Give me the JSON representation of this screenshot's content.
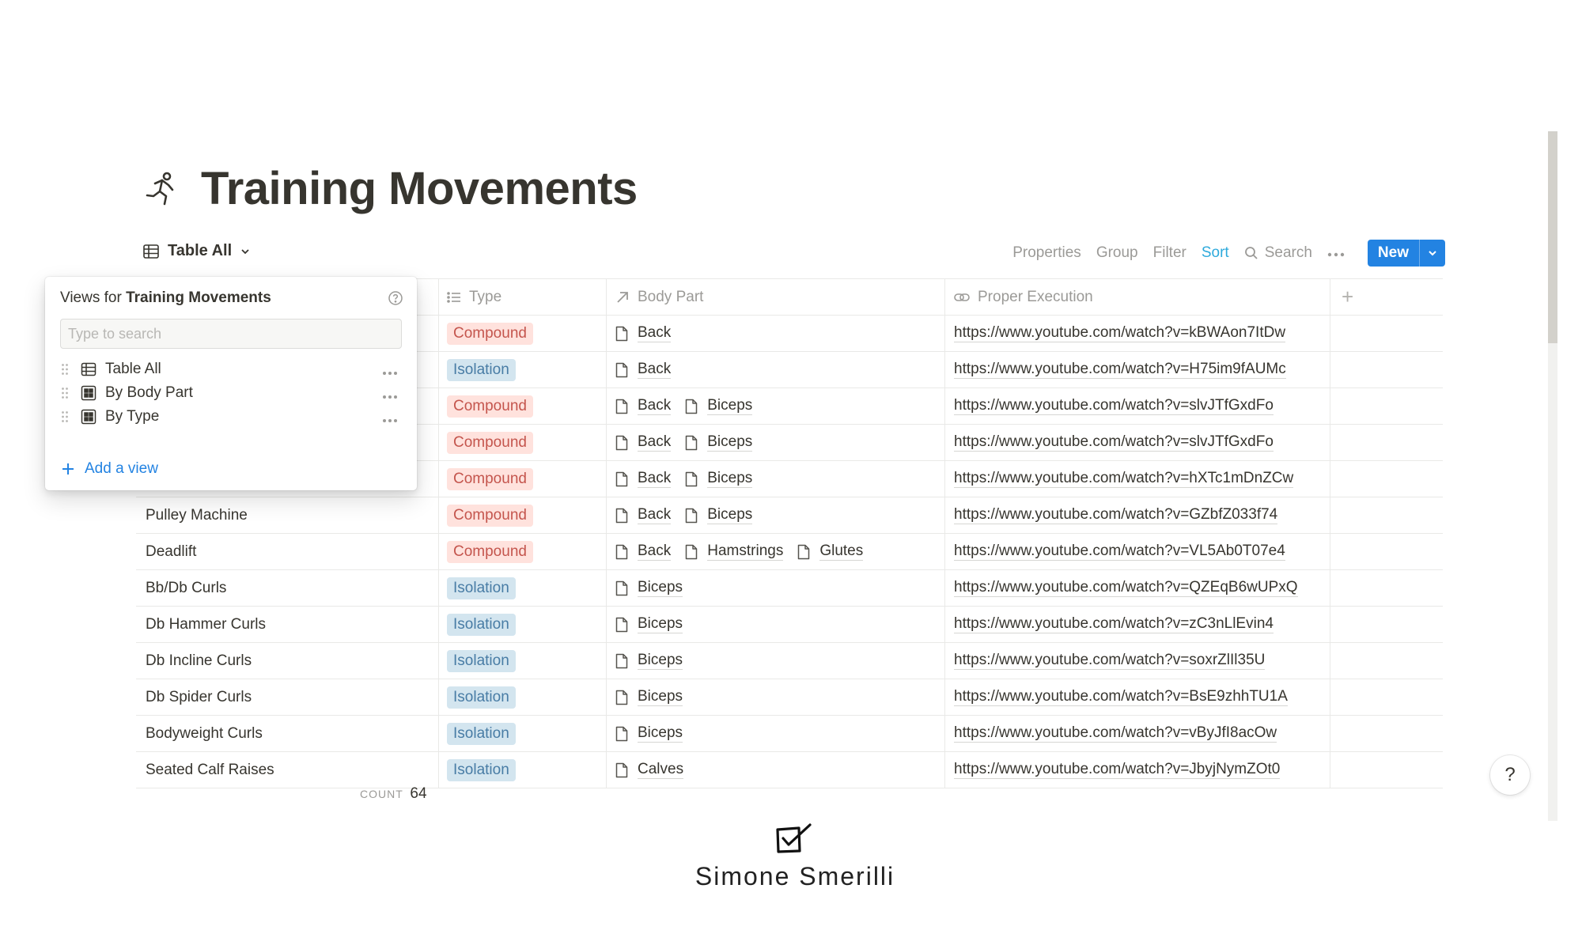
{
  "page": {
    "title": "Training Movements",
    "icon": "running-person-icon"
  },
  "toolbar": {
    "view_label": "Table All",
    "properties": "Properties",
    "group": "Group",
    "filter": "Filter",
    "sort": "Sort",
    "search": "Search",
    "new": "New"
  },
  "table": {
    "headers": {
      "type": "Type",
      "body_part": "Body Part",
      "proper_execution": "Proper Execution"
    },
    "rows": [
      {
        "name": "",
        "type": "Compound",
        "body": [
          "Back"
        ],
        "url": "https://www.youtube.com/watch?v=kBWAon7ItDw"
      },
      {
        "name": "",
        "type": "Isolation",
        "body": [
          "Back"
        ],
        "url": "https://www.youtube.com/watch?v=H75im9fAUMc"
      },
      {
        "name": "",
        "type": "Compound",
        "body": [
          "Back",
          "Biceps"
        ],
        "url": "https://www.youtube.com/watch?v=slvJTfGxdFo"
      },
      {
        "name": "",
        "type": "Compound",
        "body": [
          "Back",
          "Biceps"
        ],
        "url": "https://www.youtube.com/watch?v=slvJTfGxdFo"
      },
      {
        "name": "",
        "type": "Compound",
        "body": [
          "Back",
          "Biceps"
        ],
        "url": "https://www.youtube.com/watch?v=hXTc1mDnZCw"
      },
      {
        "name": "Pulley Machine",
        "type": "Compound",
        "body": [
          "Back",
          "Biceps"
        ],
        "url": "https://www.youtube.com/watch?v=GZbfZ033f74"
      },
      {
        "name": "Deadlift",
        "type": "Compound",
        "body": [
          "Back",
          "Hamstrings",
          "Glutes"
        ],
        "url": "https://www.youtube.com/watch?v=VL5Ab0T07e4"
      },
      {
        "name": "Bb/Db Curls",
        "type": "Isolation",
        "body": [
          "Biceps"
        ],
        "url": "https://www.youtube.com/watch?v=QZEqB6wUPxQ"
      },
      {
        "name": "Db Hammer Curls",
        "type": "Isolation",
        "body": [
          "Biceps"
        ],
        "url": "https://www.youtube.com/watch?v=zC3nLlEvin4"
      },
      {
        "name": "Db Incline Curls",
        "type": "Isolation",
        "body": [
          "Biceps"
        ],
        "url": "https://www.youtube.com/watch?v=soxrZlIl35U"
      },
      {
        "name": "Db Spider Curls",
        "type": "Isolation",
        "body": [
          "Biceps"
        ],
        "url": "https://www.youtube.com/watch?v=BsE9zhhTU1A"
      },
      {
        "name": "Bodyweight Curls",
        "type": "Isolation",
        "body": [
          "Biceps"
        ],
        "url": "https://www.youtube.com/watch?v=vByJfI8acOw"
      },
      {
        "name": "Seated Calf Raises",
        "type": "Isolation",
        "body": [
          "Calves"
        ],
        "url": "https://www.youtube.com/watch?v=JbyjNymZOt0"
      }
    ],
    "count_label": "COUNT",
    "count": "64"
  },
  "views_popup": {
    "heading_prefix": "Views for",
    "heading_db": "Training Movements",
    "search_placeholder": "Type to search",
    "views": [
      "Table All",
      "By Body Part",
      "By Type"
    ],
    "add_view": "Add a view"
  },
  "footer": {
    "author": "Simone Smerilli"
  },
  "help": "?",
  "colors": {
    "accent": "#2383e2",
    "sort_active": "#2eaadc",
    "compound_bg": "#ffe2dd",
    "compound_text": "#c4554d",
    "isolation_bg": "#d3e5ef",
    "isolation_text": "#487ca5"
  }
}
